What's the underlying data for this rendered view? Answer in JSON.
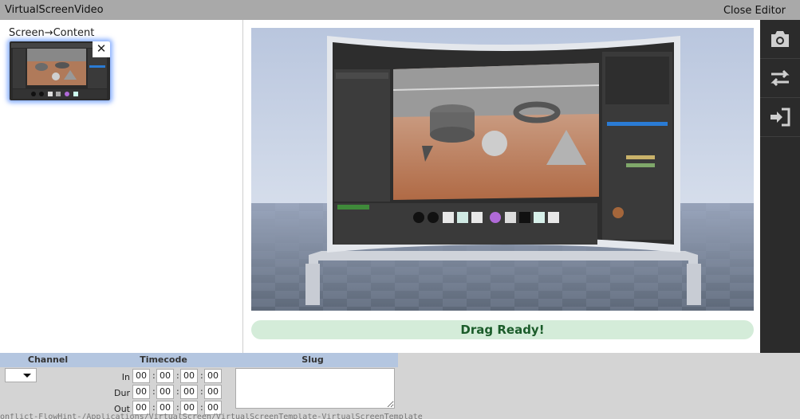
{
  "window": {
    "title": "VirtualScreenVideo",
    "close_label": "Close Editor"
  },
  "breadcrumb": "Screen→Content",
  "status": {
    "text": "Drag Ready!",
    "color": "#d4ecd9"
  },
  "toolbar": {
    "icons": [
      "camera-icon",
      "swap-icon",
      "sign-in-icon"
    ]
  },
  "panel": {
    "headers": {
      "channel": "Channel",
      "timecode": "Timecode",
      "slug": "Slug"
    },
    "channel_value": "",
    "rows": [
      {
        "label": "In",
        "values": [
          "00",
          "00",
          "00",
          "00"
        ]
      },
      {
        "label": "Dur",
        "values": [
          "00",
          "00",
          "00",
          "00"
        ]
      },
      {
        "label": "Out",
        "values": [
          "00",
          "00",
          "00",
          "00"
        ]
      }
    ],
    "slug_value": ""
  },
  "footer_text": "onflict-FlowHint-/Applications/VirtualScreen/VirtualScreenTemplate-VirtualScreenTemplate"
}
